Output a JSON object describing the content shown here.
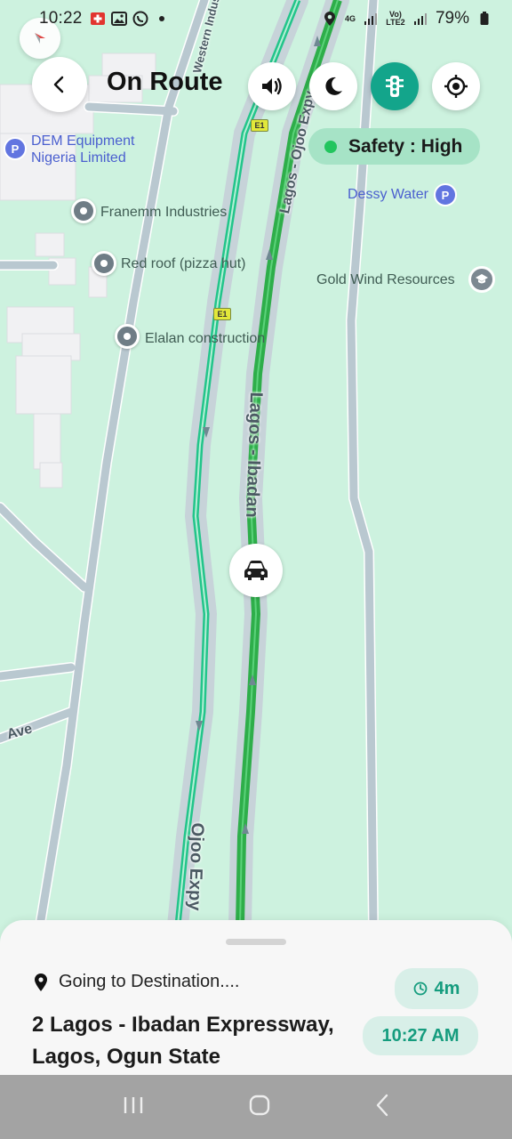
{
  "status_bar": {
    "time": "10:22",
    "network": "4G",
    "network2": "Vo) LTE2",
    "battery": "79%"
  },
  "header": {
    "title": "On Route"
  },
  "safety": {
    "label": "Safety : High",
    "status_color": "#22c55e"
  },
  "map": {
    "pois": [
      {
        "name": "DEM Equipment Nigeria Limited",
        "line1": "DEM Equipment",
        "line2": "Nigeria Limited",
        "type": "parking"
      },
      {
        "name": "Franemm Industries",
        "type": "place"
      },
      {
        "name": "Red roof (pizza hut)",
        "type": "place"
      },
      {
        "name": "Elalan construction",
        "type": "place"
      },
      {
        "name": "Dessy Water",
        "type": "parking"
      },
      {
        "name": "Gold Wind Resources",
        "type": "education"
      }
    ],
    "road_labels": {
      "main_top": "Lagos - Ojoo Expy",
      "main_mid": "Lagos - Ibadan",
      "main_bottom": "Ojoo Expy",
      "ave": "Ave",
      "western": "Western Indust"
    },
    "shields": [
      "E1",
      "E1"
    ],
    "colors": {
      "background": "#cdf2df",
      "road": "#b9c8d0",
      "route_fast": "#22c58a",
      "route_dark": "#2eae4a"
    }
  },
  "trip": {
    "status": "Going to Destination....",
    "address": "2 Lagos - Ibadan Expressway, Lagos, Ogun State",
    "eta_duration": "4m",
    "arrival_time": "10:27 AM"
  },
  "icons": {
    "compass": "compass-icon",
    "back": "chevron-left-icon",
    "sound": "speaker-icon",
    "night": "moon-icon",
    "traffic": "traffic-light-icon",
    "locate": "crosshair-icon",
    "car": "car-icon",
    "pin": "location-pin-icon",
    "clock": "clock-icon"
  }
}
